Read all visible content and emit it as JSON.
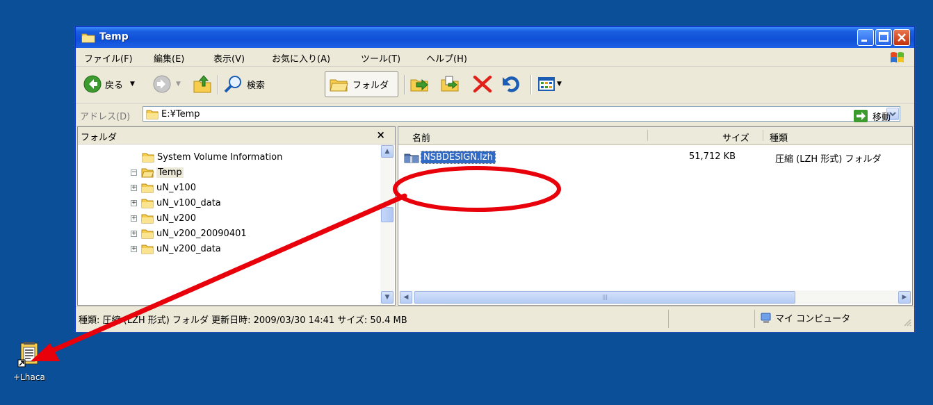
{
  "window": {
    "title": "Temp"
  },
  "menu": {
    "items": [
      "ファイル(F)",
      "編集(E)",
      "表示(V)",
      "お気に入り(A)",
      "ツール(T)",
      "ヘルプ(H)"
    ]
  },
  "toolbar": {
    "back_label": "戻る",
    "search_label": "検索",
    "folders_label": "フォルダ"
  },
  "address": {
    "label": "アドレス(D)",
    "value": "E:¥Temp",
    "go_label": "移動"
  },
  "folder_pane": {
    "title": "フォルダ",
    "close_label": "×",
    "items": [
      {
        "label": "System Volume Information",
        "expander": ""
      },
      {
        "label": "Temp",
        "expander": "−"
      },
      {
        "label": "uN_v100",
        "expander": "+"
      },
      {
        "label": "uN_v100_data",
        "expander": "+"
      },
      {
        "label": "uN_v200",
        "expander": "+"
      },
      {
        "label": "uN_v200_20090401",
        "expander": "+"
      },
      {
        "label": "uN_v200_data",
        "expander": "+"
      }
    ]
  },
  "file_list": {
    "columns": {
      "name": "名前",
      "size": "サイズ",
      "type": "種類"
    },
    "rows": [
      {
        "name": "NSBDESIGN.lzh",
        "size": "51,712 KB",
        "type": "圧縮 (LZH 形式) フォルダ"
      }
    ]
  },
  "status": {
    "text": "種類: 圧縮 (LZH 形式) フォルダ 更新日時: 2009/03/30 14:41 サイズ: 50.4 MB",
    "zone": "マイ コンピュータ"
  },
  "desktop_icon": {
    "label": "+Lhaca"
  },
  "colors": {
    "desktop": "#0a4f98",
    "titlebar": "#0f4fd6",
    "selection": "#316ac5",
    "annotation": "#e8000b"
  }
}
